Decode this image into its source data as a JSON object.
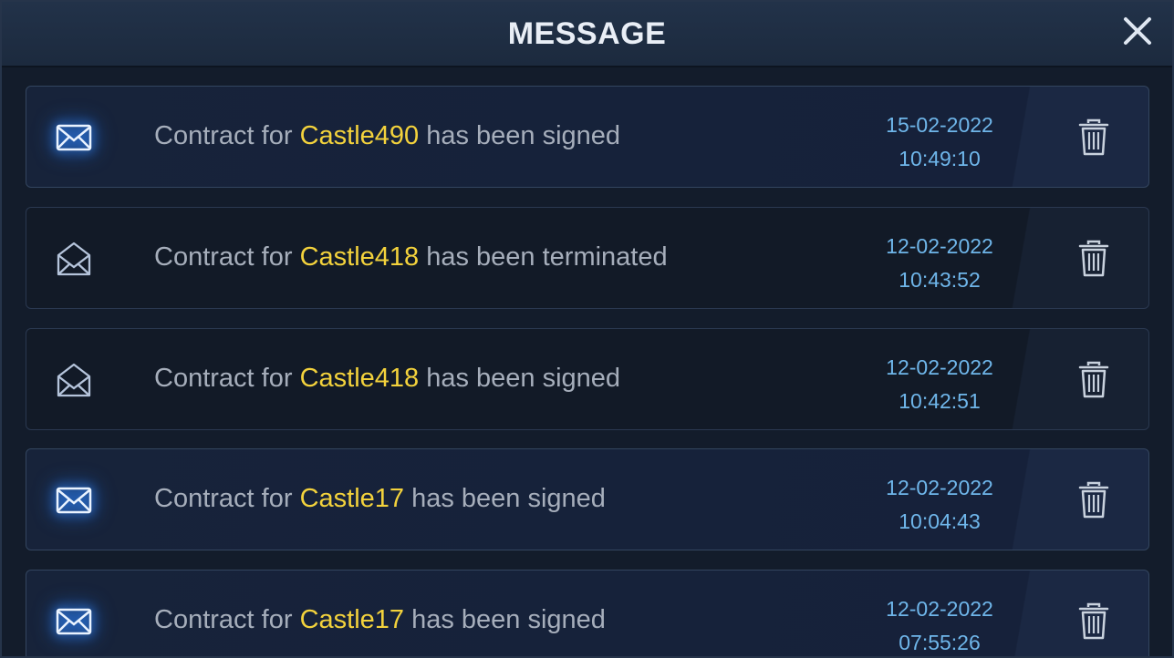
{
  "header": {
    "title": "MESSAGE",
    "close_icon": "close-icon"
  },
  "messages": [
    {
      "prefix": "Contract for ",
      "castle": "Castle490",
      "suffix": " has been signed",
      "date": "15-02-2022",
      "time": "10:49:10",
      "state": "unread"
    },
    {
      "prefix": "Contract for ",
      "castle": "Castle418",
      "suffix": " has been terminated",
      "date": "12-02-2022",
      "time": "10:43:52",
      "state": "read"
    },
    {
      "prefix": "Contract for ",
      "castle": "Castle418",
      "suffix": " has been signed",
      "date": "12-02-2022",
      "time": "10:42:51",
      "state": "read"
    },
    {
      "prefix": "Contract for ",
      "castle": "Castle17",
      "suffix": " has been signed",
      "date": "12-02-2022",
      "time": "10:04:43",
      "state": "unread"
    },
    {
      "prefix": "Contract for ",
      "castle": "Castle17",
      "suffix": " has been signed",
      "date": "12-02-2022",
      "time": "07:55:26",
      "state": "unread"
    }
  ],
  "colors": {
    "highlight": "#f3d23c",
    "timestamp": "#6fb6ea",
    "text": "#a6aebb"
  }
}
